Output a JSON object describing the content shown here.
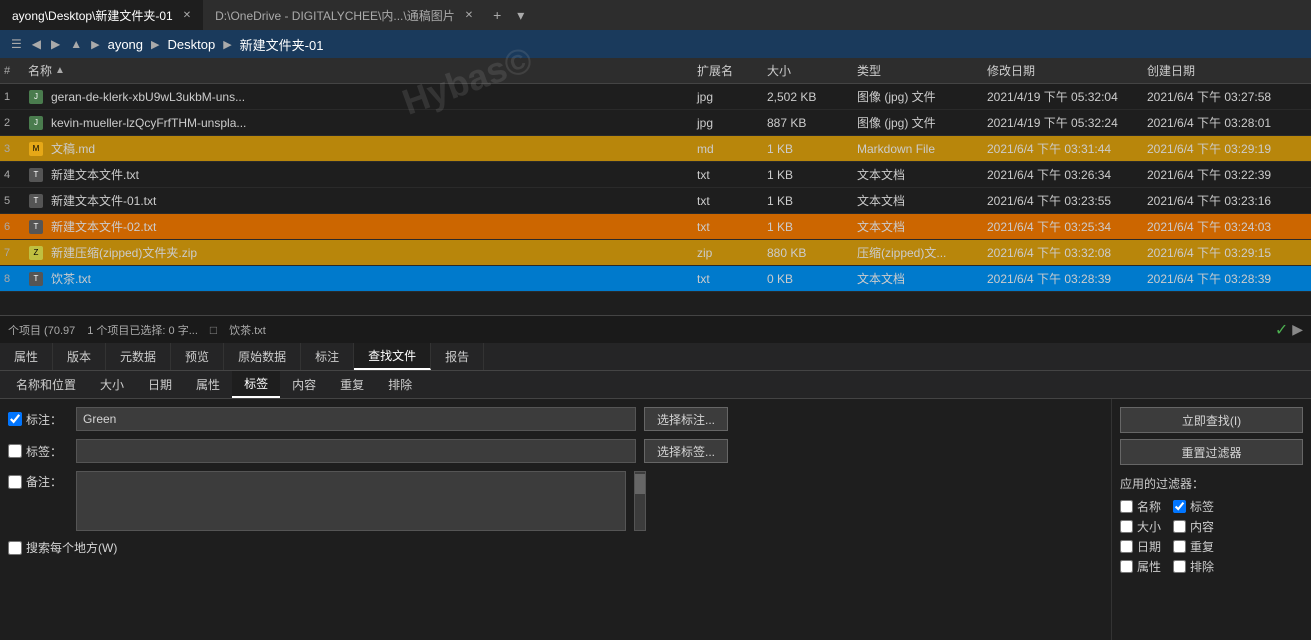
{
  "tabs": [
    {
      "label": "ayong\\Desktop\\新建文件夹-01",
      "active": true
    },
    {
      "label": "D:\\OneDrive - DIGITALYCHEE\\内...\\通稿图片",
      "active": false
    }
  ],
  "breadcrumb": {
    "items": [
      "ayong",
      "Desktop",
      "新建文件夹-01"
    ]
  },
  "file_header": {
    "num": "#",
    "name": "名称",
    "ext": "扩展名",
    "size": "大小",
    "type": "类型",
    "modified": "修改日期",
    "created": "创建日期"
  },
  "files": [
    {
      "num": "1",
      "name": "geran-de-klerk-xbU9wL3ukbM-uns...",
      "ext": "jpg",
      "size": "2,502 KB",
      "type": "图像 (jpg) 文件",
      "modified": "2021/4/19 下午 05:32:04",
      "created": "2021/6/4 下午 03:27:58",
      "icon": "jpg",
      "highlight": ""
    },
    {
      "num": "2",
      "name": "kevin-mueller-lzQcyFrfTHM-unspla...",
      "ext": "jpg",
      "size": "887 KB",
      "type": "图像 (jpg) 文件",
      "modified": "2021/4/19 下午 05:32:24",
      "created": "2021/6/4 下午 03:28:01",
      "icon": "jpg",
      "highlight": ""
    },
    {
      "num": "3",
      "name": "文稿.md",
      "ext": "md",
      "size": "1 KB",
      "type": "Markdown File",
      "modified": "2021/6/4 下午 03:31:44",
      "created": "2021/6/4 下午 03:29:19",
      "icon": "md",
      "highlight": "yellow"
    },
    {
      "num": "4",
      "name": "新建文本文件.txt",
      "ext": "txt",
      "size": "1 KB",
      "type": "文本文档",
      "modified": "2021/6/4 下午 03:26:34",
      "created": "2021/6/4 下午 03:22:39",
      "icon": "txt",
      "highlight": ""
    },
    {
      "num": "5",
      "name": "新建文本文件-01.txt",
      "ext": "txt",
      "size": "1 KB",
      "type": "文本文档",
      "modified": "2021/6/4 下午 03:23:55",
      "created": "2021/6/4 下午 03:23:16",
      "icon": "txt",
      "highlight": ""
    },
    {
      "num": "6",
      "name": "新建文本文件-02.txt",
      "ext": "txt",
      "size": "1 KB",
      "type": "文本文档",
      "modified": "2021/6/4 下午 03:25:34",
      "created": "2021/6/4 下午 03:24:03",
      "icon": "txt",
      "highlight": "orange"
    },
    {
      "num": "7",
      "name": "新建压缩(zipped)文件夹.zip",
      "ext": "zip",
      "size": "880 KB",
      "type": "压缩(zipped)文...",
      "modified": "2021/6/4 下午 03:32:08",
      "created": "2021/6/4 下午 03:29:15",
      "icon": "zip",
      "highlight": "yellow"
    },
    {
      "num": "8",
      "name": "饮茶.txt",
      "ext": "txt",
      "size": "0 KB",
      "type": "文本文档",
      "modified": "2021/6/4 下午 03:28:39",
      "created": "2021/6/4 下午 03:28:39",
      "icon": "txt",
      "highlight": "cyan"
    }
  ],
  "status": {
    "total": "个项目 (70.97",
    "selected": "1 个项目已选择: 0 字...",
    "file_icon": "□",
    "file_name": "饮茶.txt"
  },
  "bottom_tabs": [
    {
      "label": "属性"
    },
    {
      "label": "版本"
    },
    {
      "label": "元数据"
    },
    {
      "label": "预览"
    },
    {
      "label": "原始数据"
    },
    {
      "label": "标注"
    },
    {
      "label": "查找文件",
      "active": true
    },
    {
      "label": "报告"
    }
  ],
  "search_tabs": [
    {
      "label": "名称和位置"
    },
    {
      "label": "大小"
    },
    {
      "label": "日期"
    },
    {
      "label": "属性"
    },
    {
      "label": "标签",
      "active": true
    },
    {
      "label": "内容"
    },
    {
      "label": "重复"
    },
    {
      "label": "排除"
    }
  ],
  "search_panel": {
    "annotation_label": "标注：",
    "annotation_value": "Green",
    "annotation_placeholder": "Green",
    "tag_label": "标签：",
    "tag_value": "",
    "tag_placeholder": "",
    "note_label": "备注：",
    "note_value": "",
    "btn_select_annotation": "选择标注...",
    "btn_select_tag": "选择标签...",
    "checkbox_search_everywhere": "搜索每个地方(W)",
    "btn_find_now": "立即查找(I)",
    "btn_reset_filter": "重置过滤器",
    "applied_filters_label": "应用的过滤器：",
    "filters": [
      {
        "label": "名称",
        "checked": false
      },
      {
        "label": "标签",
        "checked": true
      },
      {
        "label": "大小",
        "checked": false
      },
      {
        "label": "内容",
        "checked": false
      },
      {
        "label": "日期",
        "checked": false
      },
      {
        "label": "重复",
        "checked": false
      },
      {
        "label": "属性",
        "checked": false
      },
      {
        "label": "排除",
        "checked": false
      }
    ]
  },
  "watermark": "Hybas©"
}
